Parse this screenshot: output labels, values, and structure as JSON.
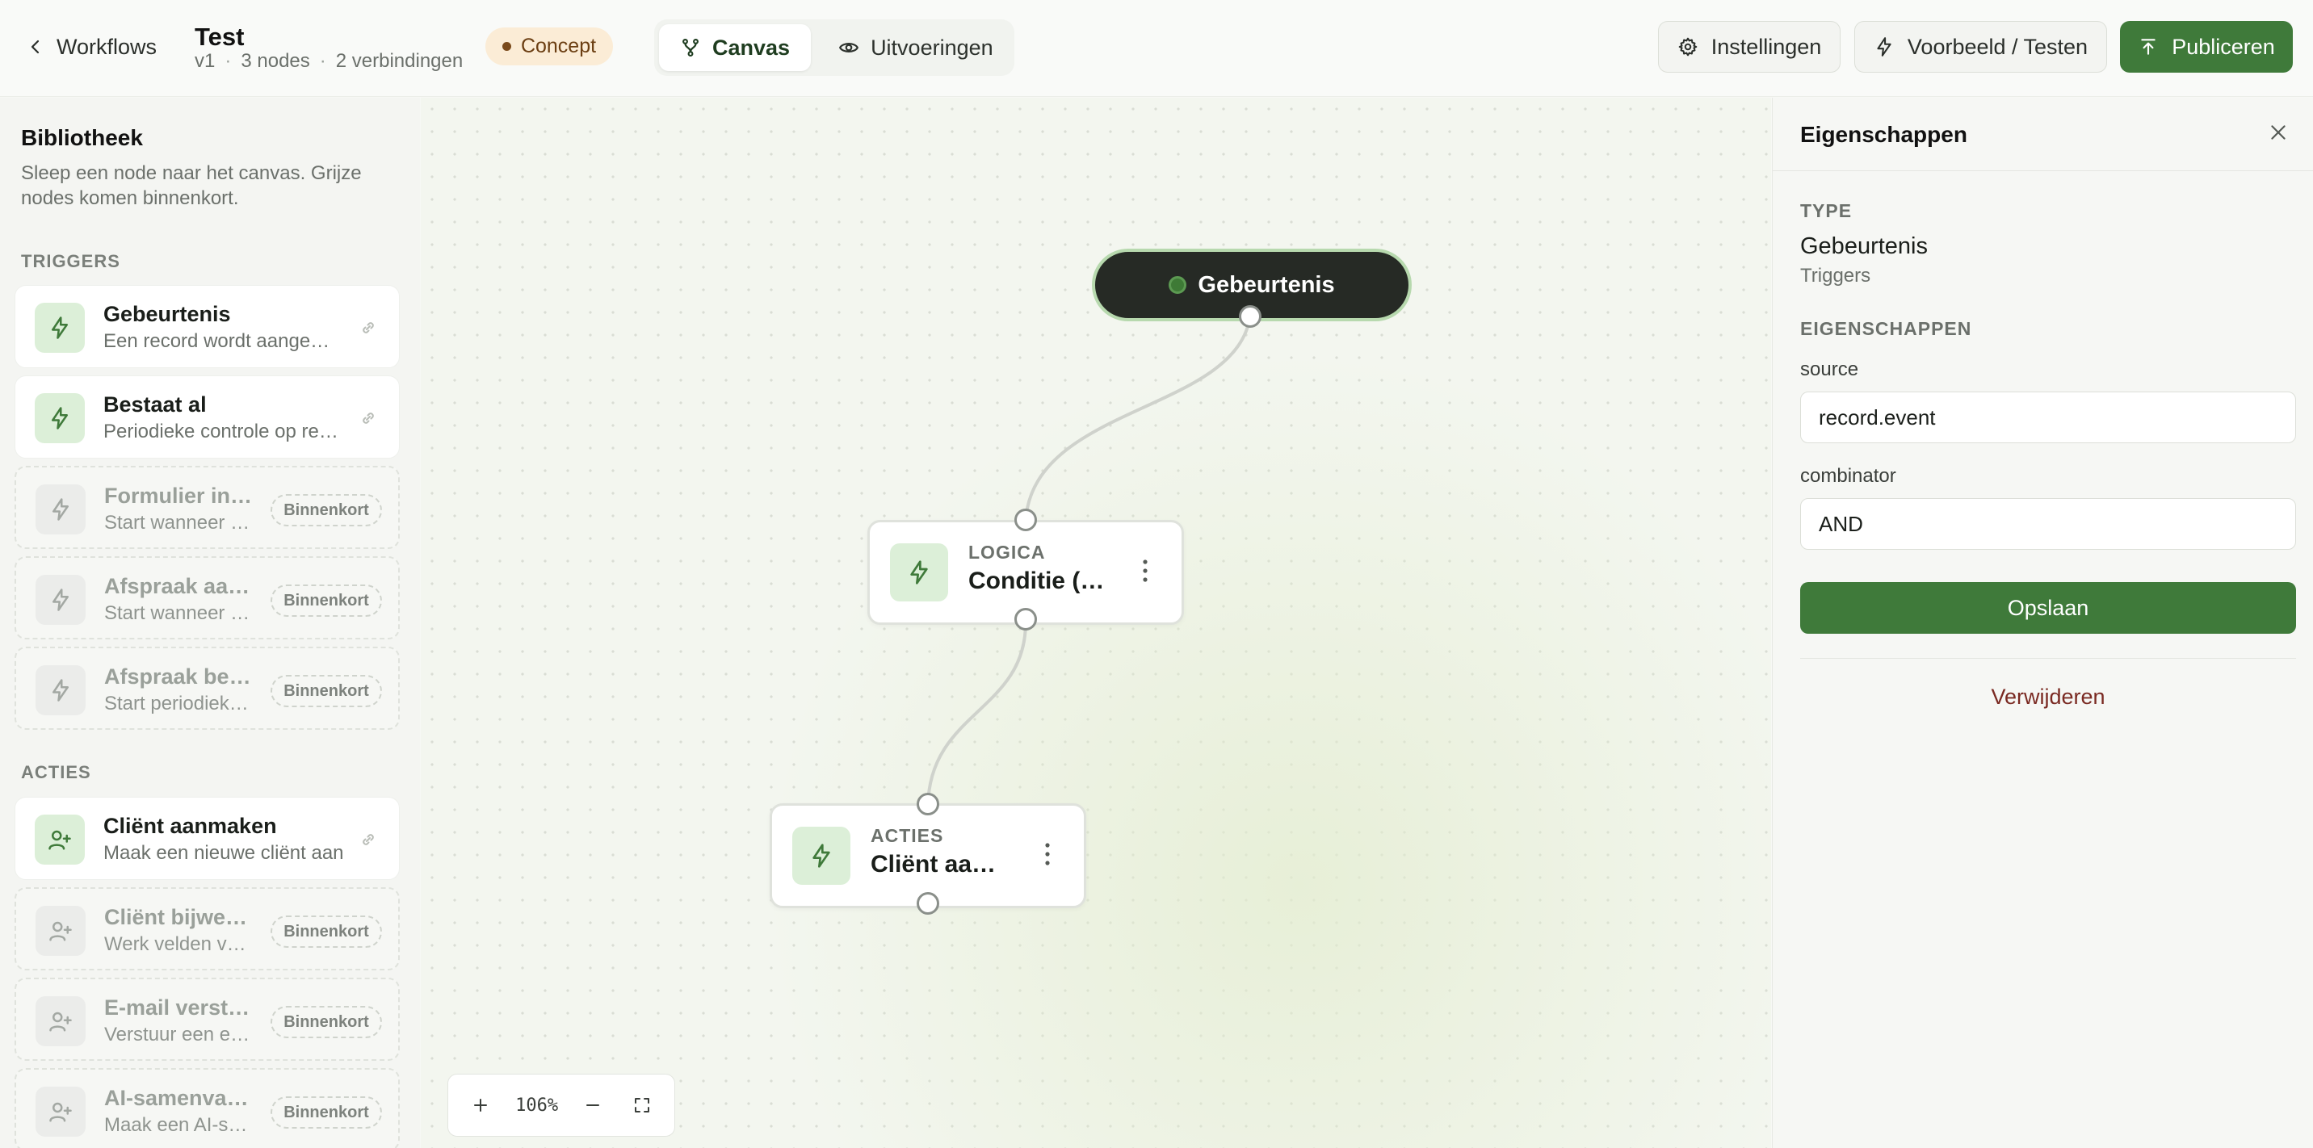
{
  "topbar": {
    "back_label": "Workflows",
    "title": "Test",
    "meta": {
      "version": "v1",
      "nodes": "3 nodes",
      "connections": "2 verbindingen",
      "sep": "·"
    },
    "status": "Concept",
    "tabs": [
      {
        "label": "Canvas",
        "icon": "branch-icon"
      },
      {
        "label": "Uitvoeringen",
        "icon": "eye-icon"
      }
    ],
    "settings_label": "Instellingen",
    "preview_label": "Voorbeeld / Testen",
    "publish_label": "Publiceren"
  },
  "library": {
    "title": "Bibliotheek",
    "description": "Sleep een node naar het canvas. Grijze nodes komen binnenkort.",
    "soon_label": "Binnenkort",
    "triggers_heading": "TRIGGERS",
    "triggers": [
      {
        "name": "Gebeurtenis",
        "desc": "Een record wordt aangemaakt of gewijzigd",
        "available": true
      },
      {
        "name": "Bestaat al",
        "desc": "Periodieke controle op records",
        "available": true
      },
      {
        "name": "Formulier ingediend",
        "desc": "Start wanneer een formulier wordt ingediend",
        "available": false
      },
      {
        "name": "Afspraak aangemaakt",
        "desc": "Start wanneer een afspraak wordt aangemaakt",
        "available": false
      },
      {
        "name": "Afspraak bestaat",
        "desc": "Start periodiek voor afspraken",
        "available": false
      }
    ],
    "actions_heading": "ACTIES",
    "actions": [
      {
        "name": "Cliënt aanmaken",
        "desc": "Maak een nieuwe cliënt aan",
        "available": true
      },
      {
        "name": "Cliënt bijwerken",
        "desc": "Werk velden van een cliënt bij",
        "available": false
      },
      {
        "name": "E-mail versturen",
        "desc": "Verstuur een e-mail",
        "available": false
      },
      {
        "name": "AI-samenvatting",
        "desc": "Maak een AI-samenvatting",
        "available": false
      }
    ]
  },
  "canvas": {
    "event_node": {
      "label": "Gebeurtenis"
    },
    "condition_node": {
      "category": "LOGICA",
      "name": "Conditie (AND)"
    },
    "action_node": {
      "category": "ACTIES",
      "name": "Cliënt aanmaken"
    },
    "zoom": {
      "level": "106%"
    }
  },
  "props": {
    "title": "Eigenschappen",
    "type_heading": "TYPE",
    "type_value": "Gebeurtenis",
    "type_group": "Triggers",
    "props_heading": "EIGENSCHAPPEN",
    "fields": [
      {
        "label": "source",
        "value": "record.event"
      },
      {
        "label": "combinator",
        "value": "AND"
      }
    ],
    "save_label": "Opslaan",
    "delete_label": "Verwijderen"
  },
  "colors": {
    "accent": "#3f7a3a",
    "status_badge_bg": "#fbecd6",
    "node_dark": "#262a25",
    "delete_text": "#7a2a22"
  }
}
